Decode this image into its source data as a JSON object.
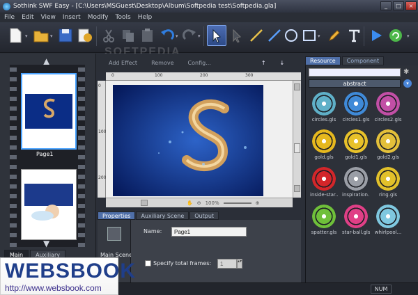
{
  "window": {
    "title": "Sothink SWF Easy - [C:\\Users\\MSGuest\\Desktop\\Album\\Softpedia test\\Softpedia.gla]"
  },
  "menu": [
    "File",
    "Edit",
    "View",
    "Insert",
    "Modify",
    "Tools",
    "Help"
  ],
  "toolbar_watermark": "SOFTPEDIA",
  "toolbar_icons": [
    "new-icon",
    "open-icon",
    "save-icon",
    "export-icon",
    "cut-icon",
    "copy-icon",
    "paste-icon",
    "undo-icon",
    "redo-icon",
    "select-arrow-icon",
    "subselect-icon",
    "line-icon",
    "pen-line-icon",
    "ellipse-icon",
    "rectangle-icon",
    "pencil-icon",
    "text-icon",
    "play-icon",
    "refresh-icon"
  ],
  "pages": {
    "items": [
      {
        "label": "Page1"
      }
    ]
  },
  "left_tabs": [
    "Main",
    "Auxiliary"
  ],
  "editor_toolbar": {
    "add_effect": "Add Effect",
    "remove": "Remove",
    "config": "Config..."
  },
  "ruler": {
    "h_ticks": [
      "0",
      "100",
      "200",
      "300"
    ],
    "v_ticks": [
      "0",
      "100",
      "200"
    ]
  },
  "zoom": "100%",
  "prop_tabs": [
    "Properties",
    "Auxiliary Scene",
    "Output"
  ],
  "properties": {
    "side_label": "Main Scene",
    "name_label": "Name:",
    "name_value": "Page1",
    "frames_label": "Specify total frames:",
    "frames_value": "1"
  },
  "resource_tabs": [
    "Resource",
    "Component"
  ],
  "resource": {
    "category": "abstract",
    "items": [
      {
        "label": "circles.gls",
        "color": "#5fb0c8"
      },
      {
        "label": "circles1.gls",
        "color": "#3f8ad8"
      },
      {
        "label": "circles2.gls",
        "color": "#c24fa6"
      },
      {
        "label": "gold.gls",
        "color": "#e6b81e"
      },
      {
        "label": "gold1.gls",
        "color": "#e8c22a"
      },
      {
        "label": "gold2.gls",
        "color": "#e3c03a"
      },
      {
        "label": "inside-star...",
        "color": "#d3262a"
      },
      {
        "label": "inspiration...",
        "color": "#9a9ea6"
      },
      {
        "label": "ring.gls",
        "color": "#e2c12a"
      },
      {
        "label": "spatter.gls",
        "color": "#6fc03a"
      },
      {
        "label": "star-ball.gls",
        "color": "#e03f86"
      },
      {
        "label": "whirlpool...",
        "color": "#7fc8e0"
      }
    ]
  },
  "status": {
    "num": "NUM"
  },
  "watermark": {
    "brand": "WEBSBOOK",
    "url": "http://www.websbook.com"
  }
}
